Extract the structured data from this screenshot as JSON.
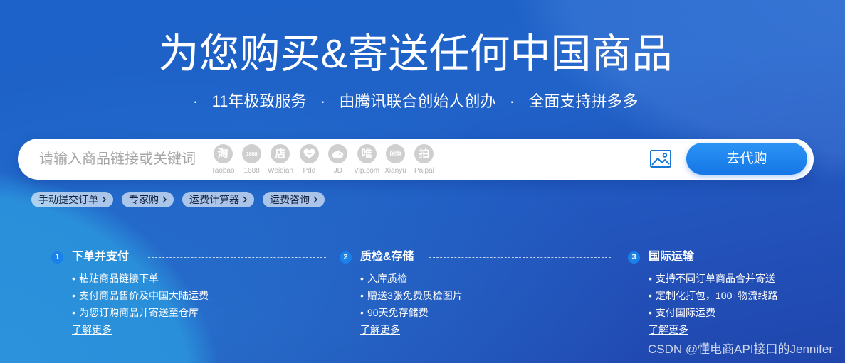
{
  "colors": {
    "background_top": "#1c62c8",
    "background_bottom": "#2046ad",
    "accent": "#1a80ea",
    "text_on_blue": "#ffffff",
    "chip_text": "#14223f",
    "platform_icon_gray": "#cfcfcf",
    "platform_label_gray": "#b3b3b3",
    "image_icon_blue": "#1976d2"
  },
  "hero": {
    "title": "为您购买&寄送任何中国商品",
    "separator": "·",
    "features": [
      "11年极致服务",
      "由腾讯联合创始人创办",
      "全面支持拼多多"
    ]
  },
  "search": {
    "placeholder": "请输入商品链接或关键词",
    "platforms": [
      {
        "glyph": "淘",
        "label": "Taobao",
        "icon": "taobao-icon"
      },
      {
        "glyph": "1688",
        "label": "1688",
        "icon": "1688-icon"
      },
      {
        "glyph": "店",
        "label": "Weidian",
        "icon": "weidian-icon"
      },
      {
        "label": "Pdd",
        "icon": "pinduoduo-icon"
      },
      {
        "label": "JD",
        "icon": "jd-dog-icon"
      },
      {
        "glyph": "唯",
        "label": "Vip.com",
        "icon": "vip-icon"
      },
      {
        "glyph": "闲鱼",
        "label": "Xianyu",
        "icon": "xianyu-icon"
      },
      {
        "glyph": "拍",
        "label": "Paipai",
        "icon": "paipai-icon"
      }
    ],
    "image_search_icon": "image-icon",
    "submit_label": "去代购"
  },
  "quick_links": [
    {
      "label": "手动提交订单",
      "icon": "chevron-right-icon"
    },
    {
      "label": "专家购",
      "icon": "chevron-right-icon"
    },
    {
      "label": "运费计算器",
      "icon": "chevron-right-icon"
    },
    {
      "label": "运费咨询",
      "icon": "chevron-right-icon"
    }
  ],
  "list_bullet": "•",
  "steps": [
    {
      "number": "1",
      "title": "下单并支付",
      "items": [
        "粘贴商品链接下单",
        "支付商品售价及中国大陆运费",
        "为您订购商品并寄送至仓库"
      ],
      "more_label": "了解更多"
    },
    {
      "number": "2",
      "title": "质检&存储",
      "items": [
        "入库质检",
        "赠送3张免费质检图片",
        "90天免存储费"
      ],
      "more_label": "了解更多"
    },
    {
      "number": "3",
      "title": "国际运输",
      "items": [
        "支持不同订单商品合并寄送",
        "定制化打包，100+物流线路",
        "支付国际运费"
      ],
      "more_label": "了解更多"
    }
  ],
  "watermark": "CSDN @懂电商API接口的Jennifer"
}
